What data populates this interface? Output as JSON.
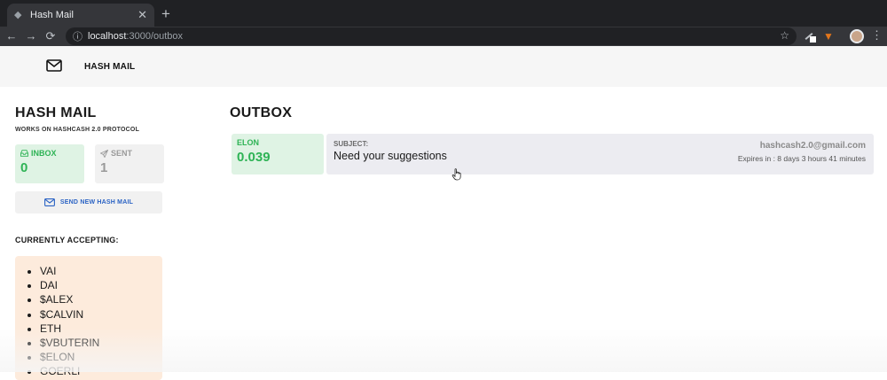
{
  "browser": {
    "tab_title": "Hash Mail",
    "tab_close": "✕",
    "new_tab": "+",
    "url_host": "localhost",
    "url_path": ":3000/outbox"
  },
  "header": {
    "title": "HASH MAIL"
  },
  "sidebar": {
    "title": "HASH MAIL",
    "subtitle": "WORKS ON HASHCASH 2.0 PROTOCOL",
    "inbox": {
      "label": "INBOX",
      "count": "0"
    },
    "sent": {
      "label": "SENT",
      "count": "1"
    },
    "send_button": "SEND NEW HASH MAIL",
    "accepting_title": "CURRENTLY ACCEPTING:",
    "accepting": [
      "VAI",
      "DAI",
      "$ALEX",
      "$CALVIN",
      "ETH",
      "$VBUTERIN",
      "$ELON",
      "GOERLI"
    ]
  },
  "outbox": {
    "title": "OUTBOX",
    "mails": [
      {
        "token": "ELON",
        "amount": "0.039",
        "subject_label": "SUBJECT:",
        "subject": "Need your suggestions",
        "from": "hashcash2.0@gmail.com",
        "expiry": "Expires in : 8 days 3 hours 41 minutes"
      }
    ]
  },
  "colors": {
    "accent_green": "#2eb355",
    "link_blue": "#2b63c4",
    "accepting_bg": "#fdebdc"
  },
  "icons": [
    "mail-icon",
    "inbox-icon",
    "send-icon",
    "star-icon",
    "lock-icon",
    "reload-icon",
    "back-icon",
    "forward-icon",
    "metamask-icon",
    "hand-cursor-icon"
  ]
}
